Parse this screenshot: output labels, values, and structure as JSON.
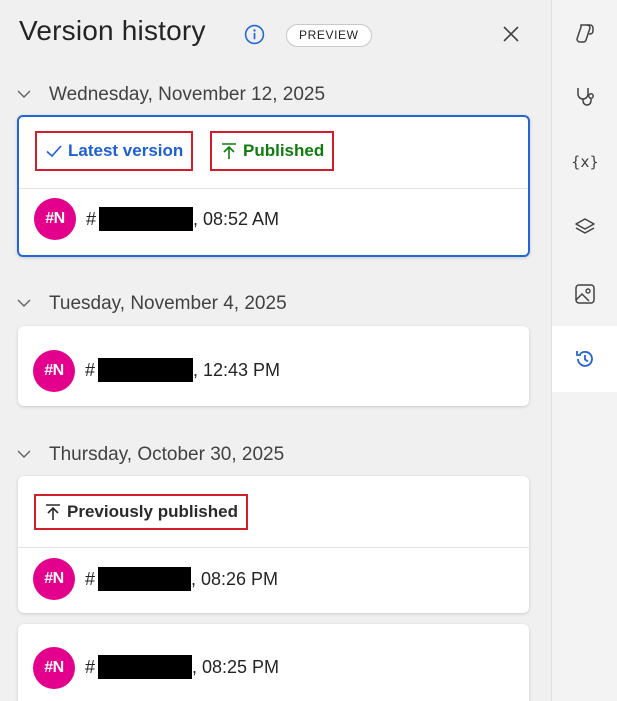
{
  "header": {
    "title": "Version history",
    "badge": "PREVIEW"
  },
  "groups": [
    {
      "date": "Wednesday, November 12, 2025",
      "tags": {
        "latest": "Latest version",
        "published": "Published"
      },
      "entries": [
        {
          "avatar": "#N",
          "hash": "#",
          "time": ", 08:52 AM"
        }
      ]
    },
    {
      "date": "Tuesday, November 4, 2025",
      "entries": [
        {
          "avatar": "#N",
          "hash": "#",
          "time": ", 12:43 PM"
        }
      ]
    },
    {
      "date": "Thursday, October 30, 2025",
      "tags": {
        "previously": "Previously published"
      },
      "entries": [
        {
          "avatar": "#N",
          "hash": "#",
          "time": ", 08:26 PM"
        },
        {
          "avatar": "#N",
          "hash": "#",
          "time": ", 08:25 PM"
        }
      ]
    }
  ],
  "rail": {
    "items": [
      {
        "icon": "copilot-icon"
      },
      {
        "icon": "stethoscope-icon"
      },
      {
        "icon": "variables-icon",
        "text": "{x}"
      },
      {
        "icon": "layers-icon"
      },
      {
        "icon": "media-icon"
      },
      {
        "icon": "history-icon",
        "active": true
      }
    ],
    "accent": "#2366d6"
  },
  "colors": {
    "selected_border": "#2366d6",
    "highlight_box": "#d21e2b",
    "avatar": "#e3008c",
    "published": "#107c10",
    "latest": "#1e5fd1"
  }
}
